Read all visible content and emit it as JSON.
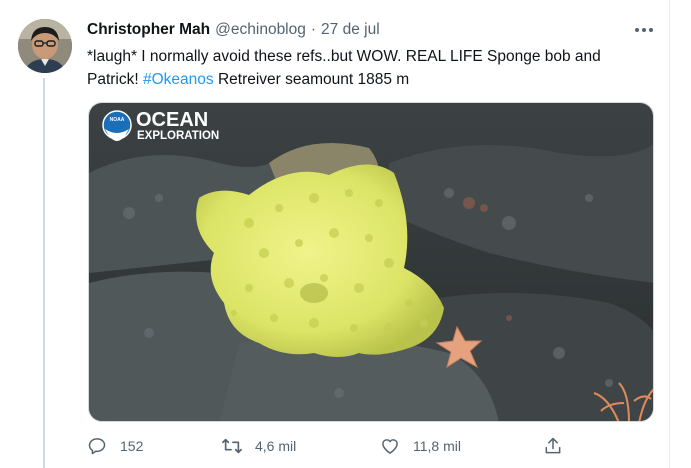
{
  "tweet": {
    "author_name": "Christopher Mah",
    "author_handle": "@echinoblog",
    "separator": "·",
    "date": "27 de jul",
    "text_line1": "*laugh* I normally avoid these refs..but WOW. REAL LIFE Sponge bob and",
    "text_line2_before": "Patrick! ",
    "hashtag": "#Okeanos",
    "text_line2_after": " Retreiver seamount  1885 m"
  },
  "media": {
    "logo_badge": "NOAA",
    "logo_line1": "OCEAN",
    "logo_line2": "EXPLORATION"
  },
  "actions": {
    "reply_count": "152",
    "retweet_count": "4,6 mil",
    "like_count": "11,8 mil"
  },
  "icons": {
    "more": "more-icon",
    "reply": "reply-icon",
    "retweet": "retweet-icon",
    "like": "like-icon",
    "share": "share-icon"
  },
  "colors": {
    "hashtag": "#1d9bf0",
    "secondary_text": "#536471",
    "sponge": "#e3ea6e",
    "starfish": "#e6a27f"
  }
}
